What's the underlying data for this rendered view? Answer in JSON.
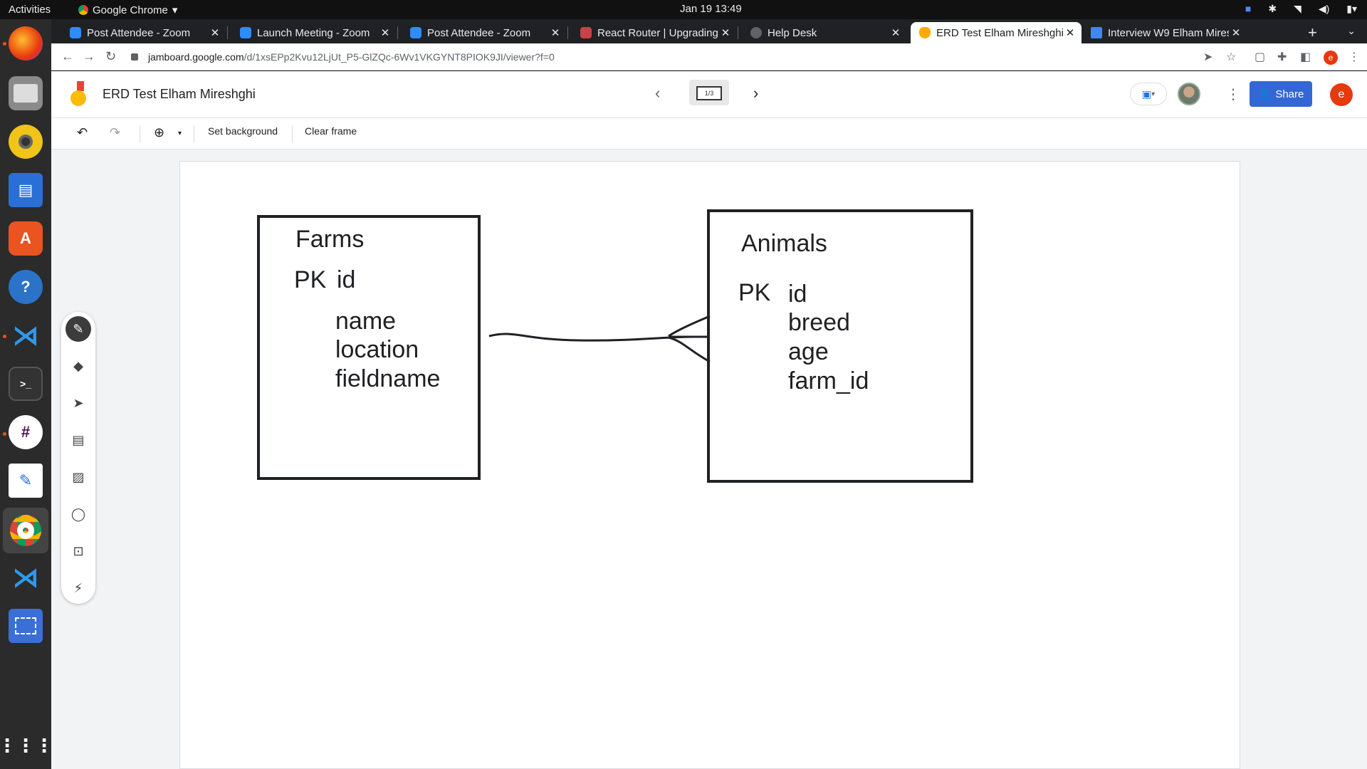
{
  "system": {
    "activities": "Activities",
    "app_name": "Google Chrome",
    "clock": "Jan 19  13:49"
  },
  "tabs": [
    {
      "label": "Post Attendee - Zoom",
      "icon": "zoom-icon"
    },
    {
      "label": "Launch Meeting - Zoom",
      "icon": "zoom-icon"
    },
    {
      "label": "Post Attendee - Zoom",
      "icon": "zoom-icon"
    },
    {
      "label": "React Router | Upgrading",
      "icon": "react-router-icon"
    },
    {
      "label": "Help Desk",
      "icon": "globe-icon"
    },
    {
      "label": "ERD Test Elham Mireshghi",
      "icon": "jamboard-icon",
      "active": true
    },
    {
      "label": "Interview W9 Elham Mireshghi",
      "icon": "docs-icon"
    }
  ],
  "address_bar": {
    "domain": "jamboard.google.com",
    "path": "/d/1xsEPp2Kvu12LjUt_P5-GlZQc-6Wv1VKGYNT8PIOK9JI/viewer?f=0"
  },
  "extensions": {
    "profile_initial": "e"
  },
  "jamboard": {
    "title": "ERD Test Elham Mireshghi",
    "frame_indicator": "1/3",
    "share_label": "Share",
    "account_initial": "e",
    "toolbar": {
      "set_background": "Set background",
      "clear_frame": "Clear frame"
    }
  },
  "diagram": {
    "farms": {
      "title": "Farms",
      "pk_label": "PK",
      "pk_field": "id",
      "fields": [
        "name",
        "location",
        "fieldname"
      ]
    },
    "animals": {
      "title": "Animals",
      "pk_label": "PK",
      "pk_field": "id",
      "fields": [
        "breed",
        "age",
        "farm_id"
      ]
    },
    "relationship": "one-to-many"
  },
  "colors": {
    "share_button": "#3367d6",
    "account_avatar": "#e8380d",
    "canvas_background": "#f1f3f4"
  }
}
